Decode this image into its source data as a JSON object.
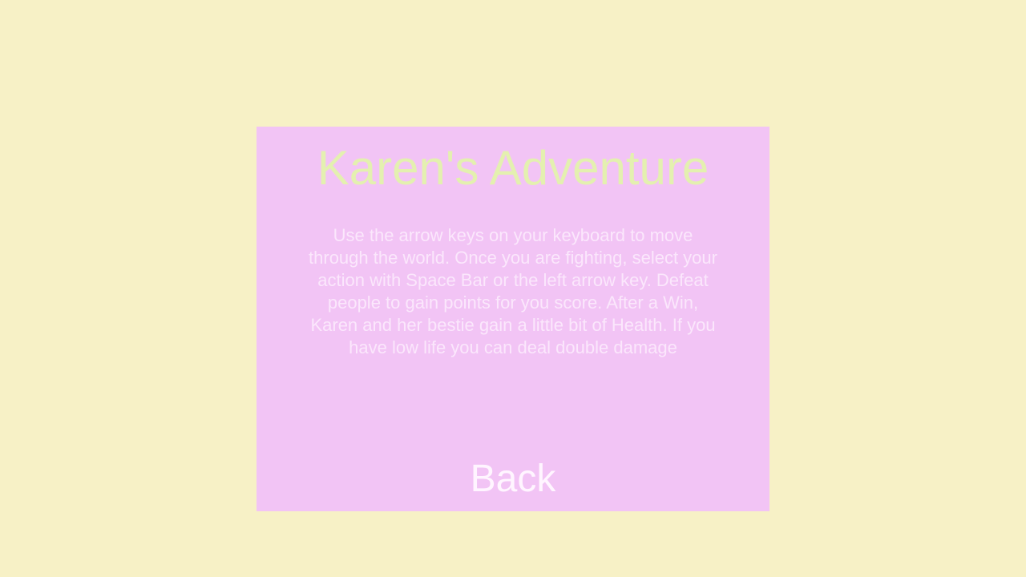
{
  "screen": {
    "background_color": "#f7f1c6",
    "panel_color": "#f2c4f5"
  },
  "panel": {
    "title": "Karen's Adventure",
    "instructions": "Use the arrow keys on your keyboard to move through the world. Once you are fighting, select your action with Space Bar or the left arrow key. Defeat people to gain points for you score. After a Win, Karen and her bestie gain a little bit of Health. If you have low life you can deal double damage",
    "back_label": "Back"
  }
}
